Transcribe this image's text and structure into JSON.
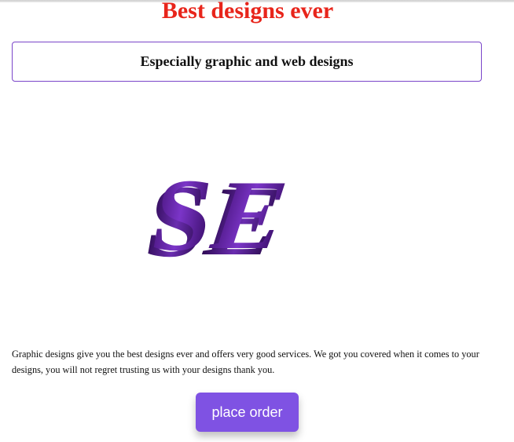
{
  "header": {
    "title": "Best designs ever"
  },
  "subtitle": {
    "text": "Especially graphic and web designs"
  },
  "logo": {
    "text": "SE",
    "description": "3D purple extruded letters logo",
    "colors": {
      "face": "#5a1f8f",
      "side": "#3a0f66",
      "highlight": "#8a46d6"
    }
  },
  "content": {
    "description": "Graphic designs give you the best designs ever and offers very good services. We got you covered when it comes to your designs, you will not regret trusting us with your designs thank you."
  },
  "actions": {
    "order_button_label": "place order"
  },
  "colors": {
    "title": "#e8251b",
    "box_border": "#7a45c9",
    "button_bg": "#7f52e3",
    "button_text": "#ffffff"
  }
}
